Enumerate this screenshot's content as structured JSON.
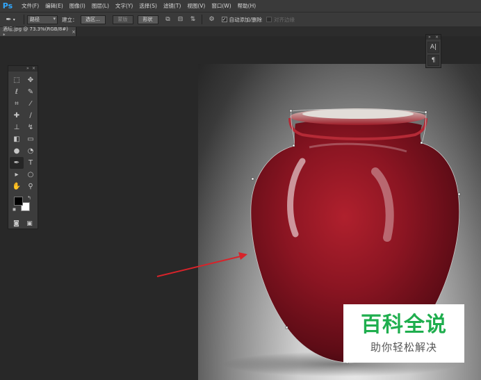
{
  "app": {
    "logo": "Ps"
  },
  "menubar": {
    "items": [
      "文件(F)",
      "编辑(E)",
      "图像(I)",
      "图层(L)",
      "文字(Y)",
      "选择(S)",
      "滤镜(T)",
      "视图(V)",
      "窗口(W)",
      "帮助(H)"
    ]
  },
  "options": {
    "tool_icon": "pen-tool-icon",
    "mode_select": "路径",
    "make_label": "建立：",
    "selection_button": "选区...",
    "mask_button": "蒙版",
    "shape_button": "形状",
    "auto_add_delete_label": "自动添加/删除",
    "auto_add_delete_checked": true,
    "align_edges_label": "对齐边缘",
    "align_edges_checked": false
  },
  "document": {
    "tab_label": "酒坛.jpg @ 73.3%(RGB/8#) *"
  },
  "tools": {
    "items": [
      {
        "icon": "rectangular-marquee-icon",
        "glyph": "⬚"
      },
      {
        "icon": "move-icon",
        "glyph": "✥"
      },
      {
        "icon": "lasso-icon",
        "glyph": "ℓ"
      },
      {
        "icon": "quick-selection-icon",
        "glyph": "✎"
      },
      {
        "icon": "crop-icon",
        "glyph": "⌗"
      },
      {
        "icon": "eyedropper-icon",
        "glyph": "⁄"
      },
      {
        "icon": "spot-healing-icon",
        "glyph": "✚"
      },
      {
        "icon": "brush-icon",
        "glyph": "∕"
      },
      {
        "icon": "clone-stamp-icon",
        "glyph": "⊥"
      },
      {
        "icon": "history-brush-icon",
        "glyph": "↯"
      },
      {
        "icon": "eraser-icon",
        "glyph": "◧"
      },
      {
        "icon": "gradient-icon",
        "glyph": "▭"
      },
      {
        "icon": "blur-icon",
        "glyph": "●"
      },
      {
        "icon": "dodge-icon",
        "glyph": "◔"
      },
      {
        "icon": "pen-icon",
        "glyph": "✒"
      },
      {
        "icon": "type-icon",
        "glyph": "T"
      },
      {
        "icon": "path-selection-icon",
        "glyph": "▸"
      },
      {
        "icon": "ellipse-shape-icon",
        "glyph": "○"
      },
      {
        "icon": "hand-icon",
        "glyph": "✋"
      },
      {
        "icon": "zoom-icon",
        "glyph": "⚲"
      }
    ],
    "active_index": 14,
    "foreground_color": "#000000",
    "background_color": "#ffffff"
  },
  "mini_panel": {
    "buttons": [
      {
        "icon": "character-panel-icon",
        "glyph": "A|"
      },
      {
        "icon": "paragraph-panel-icon",
        "glyph": "¶"
      }
    ]
  },
  "watermark": {
    "title": "百科全说",
    "subtitle": "助你轻松解决"
  },
  "colors": {
    "vase": "#8b1522",
    "arrow": "#d8232a",
    "watermark_green": "#1fae4e"
  }
}
